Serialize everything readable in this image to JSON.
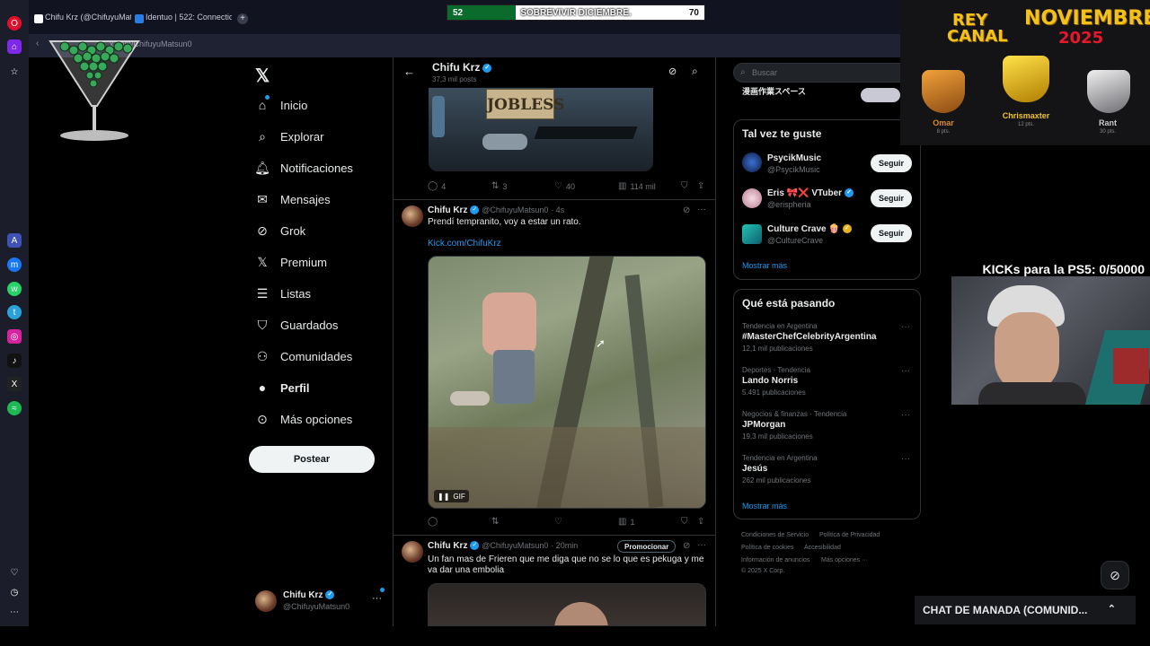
{
  "browser": {
    "tabs": [
      {
        "label": "Chifu Krz (@ChifuyuMats"
      },
      {
        "label": "Identuo | 522: Connection"
      }
    ],
    "address": "x.com/ChifuyuMatsun0"
  },
  "stream": {
    "progress": {
      "start": "52",
      "label": "SOBREVIVIR DICIEMBRE.",
      "end": "70",
      "fraction": 0.08
    },
    "rey": {
      "title_left": "REY",
      "title_left2": "CANAL",
      "title_right": "NOVIEMBRE",
      "year": "2025",
      "ranks": [
        {
          "name": "Omar",
          "pts": "8 pts.",
          "color": "#d98a2a"
        },
        {
          "name": "Chrismaxter",
          "pts": "12 pts.",
          "color": "#f2c21b"
        },
        {
          "name": "Rant",
          "pts": "30 pts.",
          "color": "#a9a9ad"
        }
      ]
    },
    "kick_goal": "KICKs para la PS5: 0/50000",
    "chat_title": "CHAT DE MANADA (COMUNID..."
  },
  "nav": {
    "items": [
      {
        "label": "Inicio",
        "icon": "home-icon"
      },
      {
        "label": "Explorar",
        "icon": "search-icon"
      },
      {
        "label": "Notificaciones",
        "icon": "bell-icon"
      },
      {
        "label": "Mensajes",
        "icon": "mail-icon"
      },
      {
        "label": "Grok",
        "icon": "grok-icon"
      },
      {
        "label": "Premium",
        "icon": "x-logo-icon"
      },
      {
        "label": "Listas",
        "icon": "list-icon"
      },
      {
        "label": "Guardados",
        "icon": "bookmark-icon"
      },
      {
        "label": "Comunidades",
        "icon": "people-icon"
      },
      {
        "label": "Perfil",
        "icon": "person-icon"
      },
      {
        "label": "Más opciones",
        "icon": "more-circle-icon"
      }
    ],
    "post_button": "Postear",
    "account": {
      "name": "Chifu Krz",
      "handle": "@ChifuyuMatsun0"
    }
  },
  "timeline": {
    "header": {
      "name": "Chifu Krz",
      "posts": "37,3 mil posts"
    },
    "top_tweet": {
      "image_text": "JOBLESS",
      "replies": "4",
      "retweets": "3",
      "likes": "40",
      "views": "114 mil"
    },
    "tweet2": {
      "name": "Chifu Krz",
      "handle": "@ChifuyuMatsun0",
      "time": "· 4s",
      "text": "Prendí tempranito, voy a estar un rato.",
      "link": "Kick.com/ChifuKrz",
      "gif_badge": "GIF",
      "views": "1"
    },
    "tweet3": {
      "name": "Chifu Krz",
      "handle": "@ChifuyuMatsun0",
      "time": "· 20min",
      "promo": "Promocionar",
      "text": "Un fan mas de Frieren que me diga que no se lo que es pekuga y me va dar una embolia"
    }
  },
  "right": {
    "search_placeholder": "Buscar",
    "top_entry": "漫画作業スペース",
    "who_to_follow": {
      "title": "Tal vez te guste",
      "users": [
        {
          "name": "PsycikMusic",
          "handle": "@PsycikMusic",
          "button": "Seguir"
        },
        {
          "name": "Eris 🎀❌ VTuber",
          "handle": "@erispheria",
          "button": "Seguir"
        },
        {
          "name": "Culture Crave 🍿",
          "handle": "@CultureCrave",
          "button": "Seguir"
        }
      ],
      "more": "Mostrar más"
    },
    "trends": {
      "title": "Qué está pasando",
      "items": [
        {
          "context": "Tendencia en Argentina",
          "name": "#MasterChefCelebrityArgentina",
          "count": "12,1 mil publicaciones"
        },
        {
          "context": "Deportes · Tendencia",
          "name": "Lando Norris",
          "count": "5.491 publicaciones"
        },
        {
          "context": "Negocios & finanzas · Tendencia",
          "name": "JPMorgan",
          "count": "19,3 mil publicaciones"
        },
        {
          "context": "Tendencia en Argentina",
          "name": "Jesús",
          "count": "262 mil publicaciones"
        }
      ],
      "more": "Mostrar más"
    },
    "footer": {
      "l1a": "Condiciones de Servicio",
      "l1b": "Política de Privacidad",
      "l2a": "Política de cookies",
      "l2b": "Accesibilidad",
      "l3a": "Información de anuncios",
      "l3b": "Más opciones ···",
      "copyright": "© 2025 X Corp."
    }
  }
}
